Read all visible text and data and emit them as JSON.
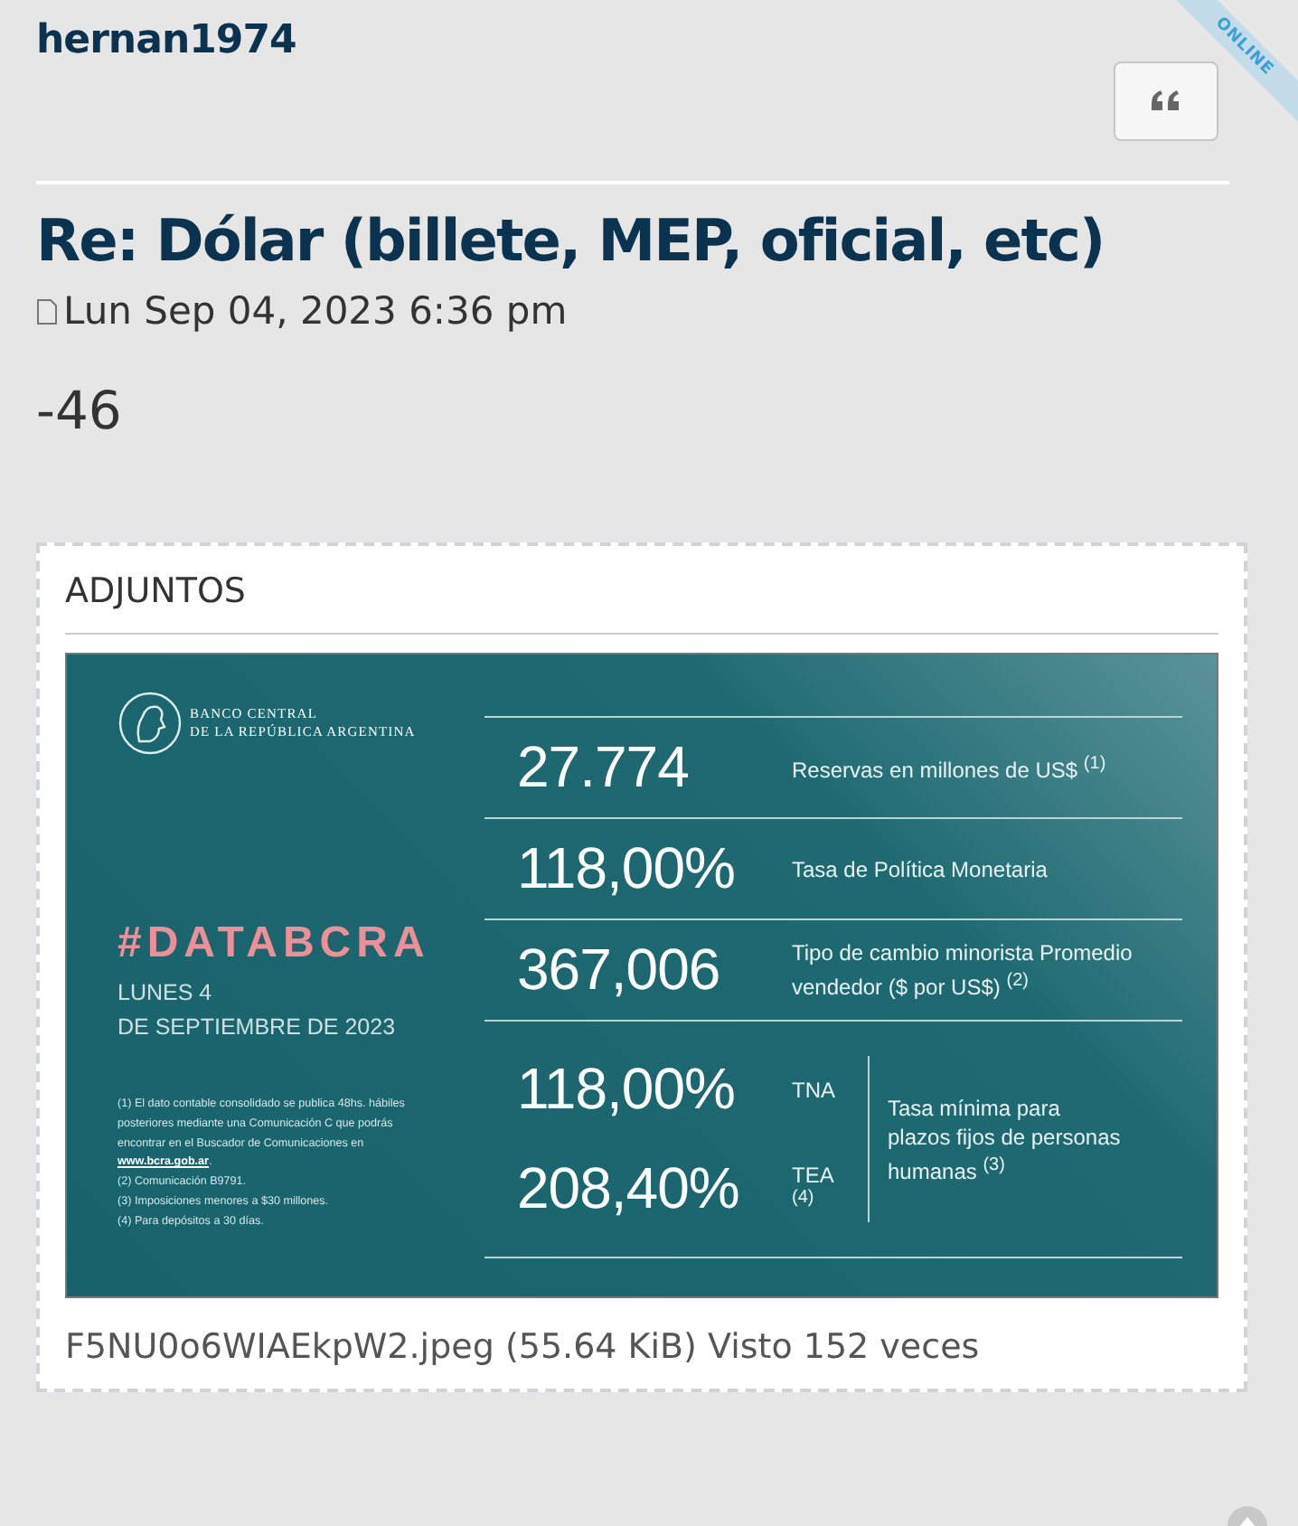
{
  "post": {
    "author": "hernan1974",
    "online_badge": "ONLINE",
    "title": "Re: Dólar (billete, MEP, oficial, etc)",
    "date": "Lun Sep 04, 2023 6:36 pm",
    "body": "-46"
  },
  "attachments": {
    "heading": "ADJUNTOS",
    "image": {
      "bank_name": [
        "BANCO CENTRAL",
        "DE LA REPÚBLICA ARGENTINA"
      ],
      "hashtag": "#DATABCRA",
      "date_lines": [
        "LUNES 4",
        "DE SEPTIEMBRE DE 2023"
      ],
      "footnotes": [
        {
          "text": "(1) El dato contable consolidado se publica 48hs. hábiles posteriores mediante una Comunicación C que podrás encontrar en el Buscador de Comunicaciones en ",
          "link": "www.bcra.gob.ar",
          "after": "."
        },
        {
          "text": "(2) Comunicación B9791."
        },
        {
          "text": "(3) Imposiciones menores a $30 millones."
        },
        {
          "text": "(4) Para depósitos a 30 días."
        }
      ],
      "stats": [
        {
          "value": "27.774",
          "label": "Reservas en millones de US$ $^{(1)}$"
        },
        {
          "value": "118,00%",
          "label": "Tasa de Política Monetaria"
        },
        {
          "value": "367,006",
          "label": "Tipo de cambio minorista Promedio vendedor ($ por US$) $^{(2)}$"
        }
      ],
      "rates": [
        {
          "value": "118,00%",
          "tag": "TNA"
        },
        {
          "value": "208,40%",
          "tag": "TEA $^{(4)}$"
        }
      ],
      "rates_label": "Tasa mínima para plazos fijos de personas humanas $^{(3)}$"
    },
    "caption": "F5NU0o6WIAEkpW2.jpeg (55.64 KiB) Visto 152 veces"
  }
}
